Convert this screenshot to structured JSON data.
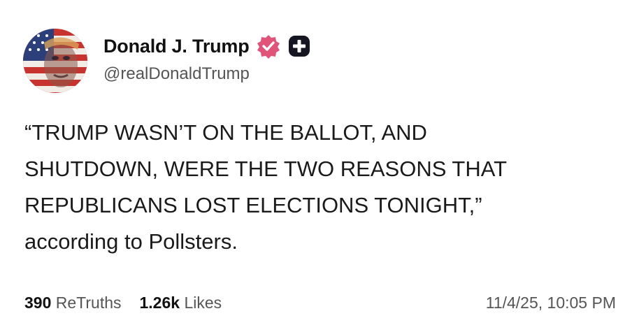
{
  "author": {
    "display_name": "Donald J. Trump",
    "handle": "@realDonaldTrump",
    "avatar_icon": "avatar-flag-portrait",
    "verified_icon": "verified-badge-icon",
    "plus_icon": "plus-badge-icon",
    "verified_color": "#e0547a"
  },
  "post": {
    "lines": [
      "“TRUMP WASN’T ON THE BALLOT, AND",
      "SHUTDOWN, WERE THE TWO REASONS THAT",
      "REPUBLICANS LOST ELECTIONS TONIGHT,”",
      "according to Pollsters."
    ]
  },
  "stats": {
    "retruths_count": "390",
    "retruths_label": "ReTruths",
    "likes_count": "1.26k",
    "likes_label": "Likes",
    "timestamp": "11/4/25, 10:05 PM"
  }
}
